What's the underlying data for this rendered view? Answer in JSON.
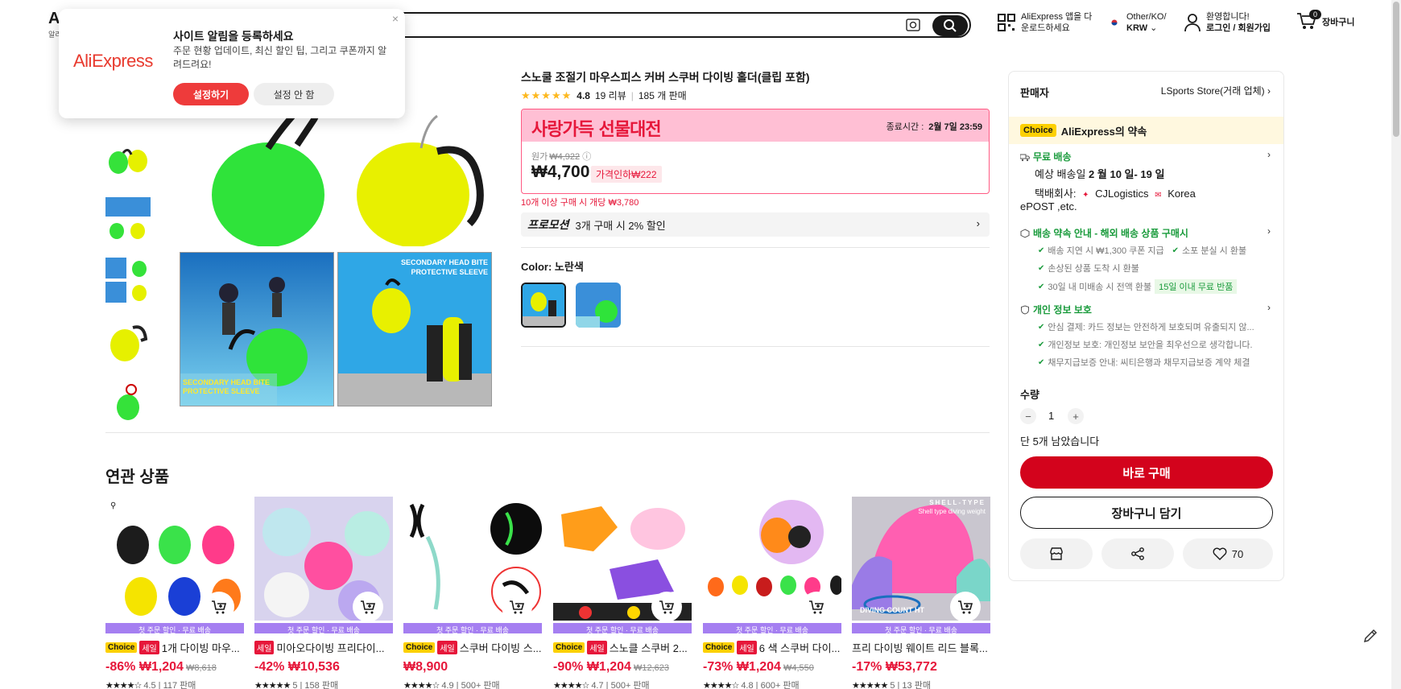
{
  "header": {
    "logo_fragment": "A",
    "logo_sub": "알리",
    "app_download": [
      "AliExpress 앱을 다",
      "운로드하세요"
    ],
    "region_line": "Other/KO/",
    "currency": "KRW",
    "greeting": "환영합니다!",
    "login": "로그인 / 회원가입",
    "cart_count": "0",
    "cart_label": "장바구니"
  },
  "popup": {
    "logo": "AliExpress",
    "title": "사이트 알림을 등록하세요",
    "desc": "주문 현황 업데이트, 최신 할인 팁, 그리고 쿠폰까지 알려드려요!",
    "allow": "설정하기",
    "deny": "설정 안 함",
    "close": "×"
  },
  "product": {
    "title": "스노쿨 조절기 마우스피스 커버 스쿠버 다이빙 홀더(클립 포함)",
    "stars": "★★★★★",
    "rating": "4.8",
    "reviews": "19 리뷰",
    "sold": "185 개 판매",
    "sale_name": "사랑가득 선물대전",
    "sale_end_label": "종료시간 :",
    "sale_end": "2월 7일 23:59",
    "orig_label": "원가",
    "orig_price": "₩4,922",
    "price": "₩4,700",
    "discount": "가격인하₩222",
    "bulk": "10개 이상 구매 시 개당 ₩3,780",
    "promo_label": "프로모션",
    "promo_text": "3개 구매 시 2% 할인",
    "color_label": "Color:",
    "color_value": "노란색",
    "img_text_left": [
      "SECONDARY HEAD BITE",
      "PROTECTIVE SLEEVE"
    ],
    "img_text_right": [
      "SECONDARY HEAD BITE",
      "PROTECTIVE SLEEVE"
    ]
  },
  "panel": {
    "seller_label": "판매자",
    "store": "LSports Store(거래 업체)",
    "choice_tag": "Choice",
    "choice_promise": "AliExpress의 약속",
    "free_ship": "무료 배송",
    "eta_prefix": "예상 배송일",
    "eta": "2 월 10 일- 19 일",
    "carrier_label": "택배회사:",
    "carrier": "CJLogistics",
    "carrier2": "Korea",
    "carrier3": "ePOST ,etc.",
    "guarantee_title": "배송 약속 안내 - 해외 배송 상품 구매시",
    "g1": "배송 지연 시 ₩1,300 쿠폰 지급",
    "g2": "소포 분실 시 환불",
    "g3": "손상된 상품 도착 시 환불",
    "g4": "30일 내 미배송 시 전액 환불",
    "g4_tag": "15일 이내 무료 반품",
    "privacy_title": "개인 정보 보호",
    "p1": "안심 결제: 카드 정보는 안전하게 보호되며 유출되지 않...",
    "p2": "개인정보 보호: 개인정보 보안을 최우선으로 생각합니다.",
    "p3": "채무지급보증 안내: 씨티은행과 채무지급보증 계약 체결",
    "qty_label": "수량",
    "qty_minus": "−",
    "qty": "1",
    "qty_plus": "+",
    "stock": "단 5개 남았습니다",
    "buy": "바로 구매",
    "add_cart": "장바구니 담기",
    "wish_count": "70"
  },
  "related": {
    "title": "연관 상품",
    "banner": "첫 주문 할인 · 무료 배송",
    "items": [
      {
        "choice": "Choice",
        "sale": "세일",
        "name": "1개 다이빙 마우...",
        "pct": "-86%",
        "price": "₩1,204",
        "orig": "₩8,618",
        "stars": "★★★★☆",
        "rating": "4.5",
        "sold": "117 판매"
      },
      {
        "choice": "",
        "sale": "세일",
        "name": "미아오다이빙 프리다이...",
        "pct": "-42%",
        "price": "₩10,536",
        "orig": "",
        "stars": "★★★★★",
        "rating": "5",
        "sold": "158 판매"
      },
      {
        "choice": "Choice",
        "sale": "세일",
        "name": "스쿠버 다이빙 스...",
        "pct": "",
        "price": "₩8,900",
        "orig": "",
        "stars": "★★★★☆",
        "rating": "4.9",
        "sold": "500+ 판매"
      },
      {
        "choice": "Choice",
        "sale": "세일",
        "name": "스노클 스쿠버 2...",
        "pct": "-90%",
        "price": "₩1,204",
        "orig": "₩12,623",
        "stars": "★★★★☆",
        "rating": "4.7",
        "sold": "500+ 판매"
      },
      {
        "choice": "Choice",
        "sale": "세일",
        "name": "6 색 스쿠버 다이...",
        "pct": "-73%",
        "price": "₩1,204",
        "orig": "₩4,550",
        "stars": "★★★★☆",
        "rating": "4.8",
        "sold": "600+ 판매"
      },
      {
        "choice": "",
        "sale": "",
        "name": "프리 다이빙 웨이트 리드 블록...",
        "pct": "-17%",
        "price": "₩53,772",
        "orig": "",
        "stars": "★★★★★",
        "rating": "5",
        "sold": "13 판매"
      }
    ],
    "shell_text": [
      "SHELL-TYPE",
      "Shell type diving weight",
      "DIVING COUNT",
      "HT"
    ]
  },
  "colors": {
    "accent": "#d3031c",
    "sale_red": "#e6173a",
    "green": "#1a9b3c",
    "choice_yellow": "#fdd000",
    "banner_purple": "#a57ff1"
  }
}
